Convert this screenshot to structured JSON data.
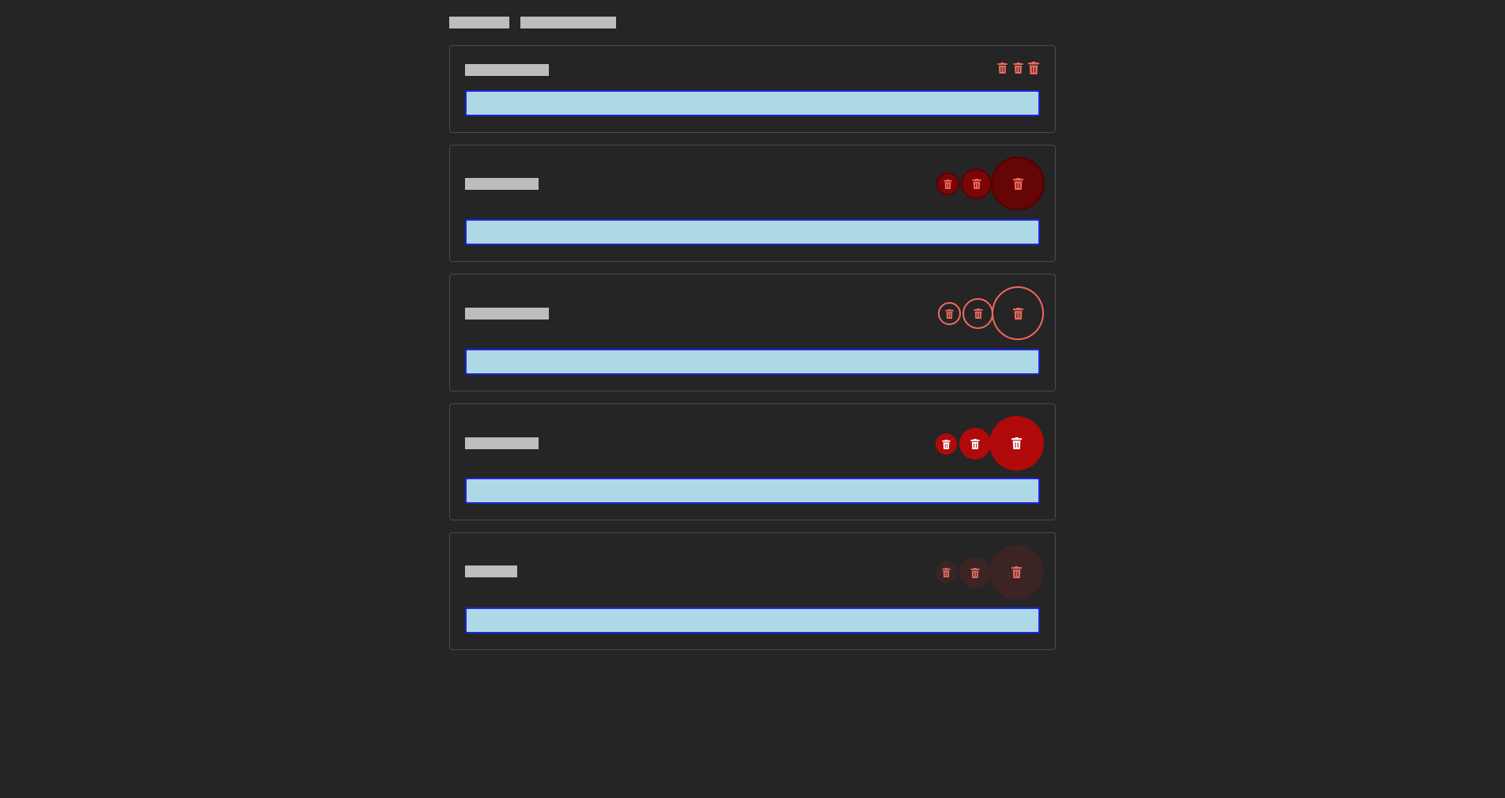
{
  "header": {
    "links": [
      {
        "label": ""
      },
      {
        "label": ""
      }
    ]
  },
  "cards": [
    {
      "title": "",
      "input_value": "",
      "variant": "plain"
    },
    {
      "title": "",
      "input_value": "",
      "variant": "dark"
    },
    {
      "title": "",
      "input_value": "",
      "variant": "outline"
    },
    {
      "title": "",
      "input_value": "",
      "variant": "filled-red"
    },
    {
      "title": "",
      "input_value": "",
      "variant": "ghost"
    }
  ],
  "icons": {
    "delete": "trash-icon"
  },
  "colors": {
    "background": "#252525",
    "input_fill": "#add8e6",
    "input_border": "#2222dd",
    "icon_red": "#f2695f",
    "dark_red": "#7a0606",
    "filled_red": "#b00a0a",
    "ghost_red": "#3c2424"
  }
}
